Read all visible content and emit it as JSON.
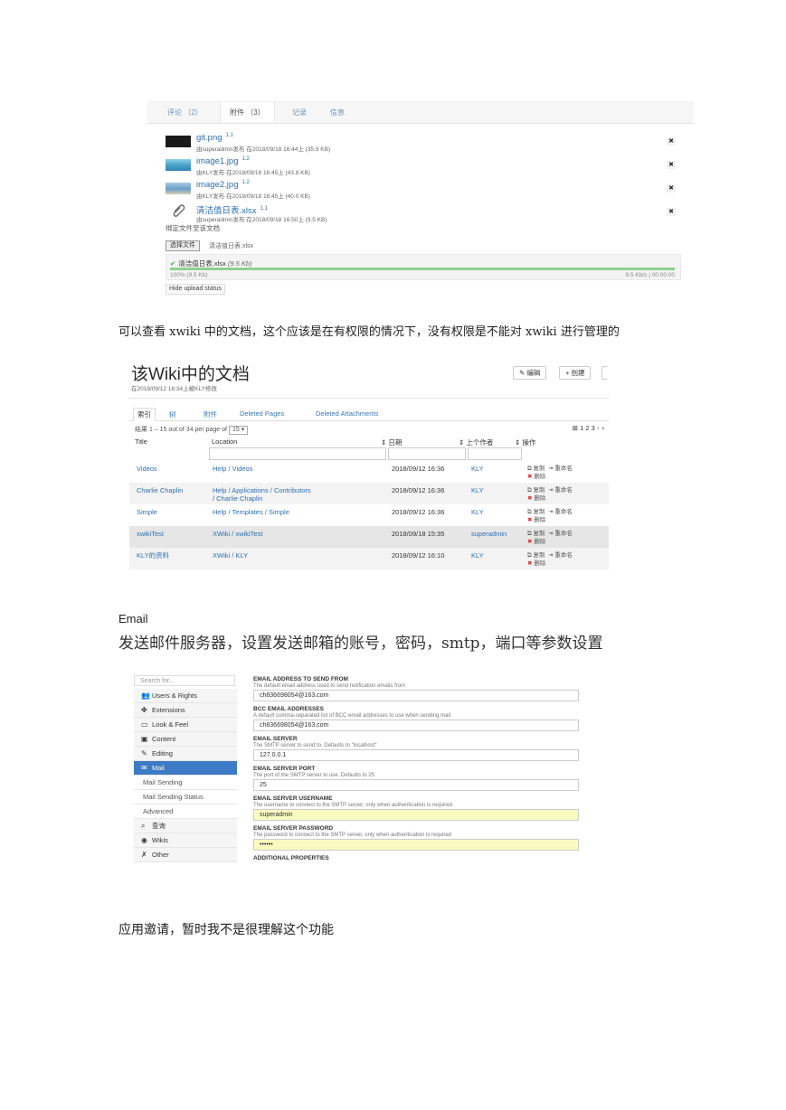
{
  "attachments_panel": {
    "tabs": [
      "评论 （2）",
      "附件 （3）",
      "记录",
      "信息"
    ],
    "files": [
      {
        "name": "git.png",
        "version": "1.1",
        "meta": "由superadmin发布 在2018/09/18 16:44上 (35.9 KB)",
        "thumb": "dark",
        "thumb_color": "#1a1a1a"
      },
      {
        "name": "image1.jpg",
        "version": "1.2",
        "meta": "由KLY发布 在2018/09/18 16:45上 (43.8 KB)",
        "thumb": "sea",
        "thumb_color": "#4aa3c9"
      },
      {
        "name": "image2.jpg",
        "version": "1.2",
        "meta": "由KLY发布 在2018/09/18 16:45上 (40.0 KB)",
        "thumb": "beach",
        "thumb_color": "#7fb1d6"
      },
      {
        "name": "清洁值日表.xlsx",
        "version": "1.1",
        "meta": "由superadmin发布 在2018/09/18 16:50上 (9.5 KB)",
        "thumb": "paperclip-icon",
        "thumb_color": ""
      }
    ],
    "delete_glyph": "✖",
    "attach_hint": "绑定文件至该文档",
    "choose_button": "选择文件",
    "chosen_file": "清洁值日表.xlsx",
    "upload": {
      "file": "清洁值日表.xlsx",
      "size": "(9.5 Kb)",
      "percent_text": "100%  (9.5 Kb)",
      "progress": 1.0,
      "speed": "9.5 Kb/s | 00:00:00"
    },
    "hide_button": "Hide upload status"
  },
  "para1": "可以查看 xwiki 中的文档，这个应该是在有权限的情况下，没有权限是不能对 xwiki 进行管理的",
  "docs_panel": {
    "title": "该Wiki中的文档",
    "subtitle": "在2018/09/12 16:34上被KLY修改",
    "buttons": [
      "✎ 编辑",
      "+ 创建"
    ],
    "tabs": [
      "索引",
      "树",
      "附件",
      "Deleted Pages",
      "Deleted Attachments"
    ],
    "results": "结果 1 – 15 out of 34  per page of",
    "per_page": "15 ▾",
    "pager": "⊞ 1 2 3",
    "columns": [
      "Title",
      "Location",
      "⇕ 日期",
      "⇕ 上个作者",
      "⇕ 操作"
    ],
    "rows": [
      {
        "title": "Videos",
        "loc1": "Help / Videos",
        "loc2": "",
        "date": "2018/09/12 16:36",
        "author": "KLY",
        "copy": "复制",
        "rename": "重命名",
        "delete": "删除"
      },
      {
        "title": "Charlie Chaplin",
        "loc1": "Help / Applications / Contributors",
        "loc2": "/ Charlie Chaplin",
        "date": "2018/09/12 16:36",
        "author": "KLY",
        "copy": "复制",
        "rename": "重命名",
        "delete": "删除"
      },
      {
        "title": "Simple",
        "loc1": "Help / Templates / Simple",
        "loc2": "",
        "date": "2018/09/12 16:36",
        "author": "KLY",
        "copy": "复制",
        "rename": "重命名",
        "delete": "删除"
      },
      {
        "title": "xwikiTest",
        "loc1": "XWiki / xwikiTest",
        "loc2": "",
        "date": "2018/09/18 15:35",
        "author": "superadmin",
        "copy": "复制",
        "rename": "重命名",
        "delete": "删除"
      },
      {
        "title": "KLY的资料",
        "loc1": "XWiki / KLY",
        "loc2": "",
        "date": "2018/09/12 16:10",
        "author": "KLY",
        "copy": "复制",
        "rename": "重命名",
        "delete": "删除"
      }
    ]
  },
  "email_heading": "Email",
  "para2": "发送邮件服务器，设置发送邮箱的账号，密码，smtp，端口等参数设置",
  "mail_panel": {
    "search_placeholder": "Search for...",
    "menu": [
      {
        "label": "Users & Rights",
        "icon": "users-icon",
        "glyph": "👥",
        "style": "main"
      },
      {
        "label": "Extensions",
        "icon": "puzzle-icon",
        "glyph": "✤",
        "style": "main"
      },
      {
        "label": "Look & Feel",
        "icon": "layout-icon",
        "glyph": "▭",
        "style": "main"
      },
      {
        "label": "Content",
        "icon": "content-icon",
        "glyph": "▣",
        "style": "main"
      },
      {
        "label": "Editing",
        "icon": "pencil-icon",
        "glyph": "✎",
        "style": "main"
      },
      {
        "label": "Mail",
        "icon": "mail-icon",
        "glyph": "✉",
        "style": "active"
      },
      {
        "label": "Mail Sending",
        "icon": "",
        "glyph": "",
        "style": "sub"
      },
      {
        "label": "Mail Sending Status",
        "icon": "",
        "glyph": "",
        "style": "sub"
      },
      {
        "label": "Advanced",
        "icon": "",
        "glyph": "",
        "style": "sub"
      },
      {
        "label": "查询",
        "icon": "search-icon",
        "glyph": "⌕",
        "style": "main"
      },
      {
        "label": "Wikis",
        "icon": "globe-icon",
        "glyph": "◉",
        "style": "main"
      },
      {
        "label": "Other",
        "icon": "wrench-icon",
        "glyph": "✗",
        "style": "main"
      }
    ],
    "fields": [
      {
        "label": "EMAIL ADDRESS TO SEND FROM",
        "hint": "The default email address used to send notification emails from",
        "value": "ch836698054@163.com",
        "highlight": false
      },
      {
        "label": "BCC EMAIL ADDRESSES",
        "hint": "A default comma-separated list of BCC email addresses to use when sending mail",
        "value": "ch836698054@163.com",
        "highlight": false
      },
      {
        "label": "EMAIL SERVER",
        "hint": "The SMTP server to send to. Defaults to \"localhost\"",
        "value": "127.0.0.1",
        "highlight": false
      },
      {
        "label": "EMAIL SERVER PORT",
        "hint": "The port of the SMTP server to use. Defaults to 25",
        "value": "25",
        "highlight": false
      },
      {
        "label": "EMAIL SERVER USERNAME",
        "hint": "The username to connect to the SMTP server, only when authentication is required",
        "value": "superadmin",
        "highlight": true
      },
      {
        "label": "EMAIL SERVER PASSWORD",
        "hint": "The password to connect to the SMTP server, only when authentication is required",
        "value": "••••••",
        "highlight": true
      },
      {
        "label": "ADDITIONAL PROPERTIES",
        "hint": "",
        "value": "",
        "highlight": false
      }
    ]
  },
  "para3": "应用邀请，暂时我不是很理解这个功能"
}
